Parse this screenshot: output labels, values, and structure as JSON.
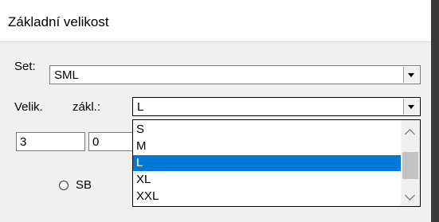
{
  "dialog": {
    "title": "Základní velikost"
  },
  "set": {
    "label": "Set:",
    "value": "SML"
  },
  "base_size": {
    "label_velik": "Velik.",
    "label_zakl": "zákl.:",
    "value": "L",
    "options": [
      "S",
      "M",
      "L",
      "XL",
      "XXL"
    ],
    "selected_index": 2
  },
  "fields": {
    "field1": "3",
    "field2": "0"
  },
  "radio_sb": {
    "label": "SB"
  },
  "colors": {
    "selection": "#0078d7"
  }
}
